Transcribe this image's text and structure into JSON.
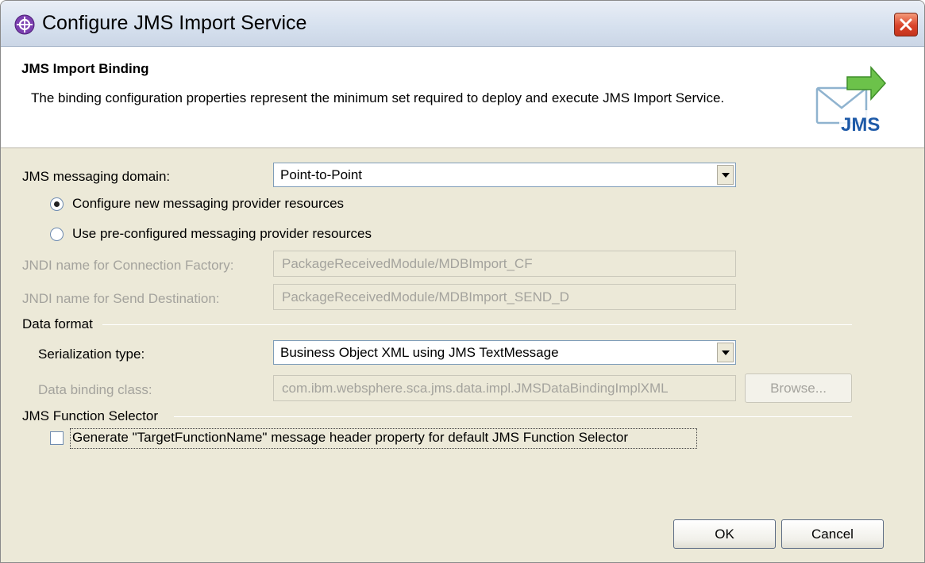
{
  "window": {
    "title": "Configure JMS Import Service",
    "app_icon": "eclipse-plugin-icon",
    "close_icon": "close-icon"
  },
  "header": {
    "title": "JMS Import Binding",
    "description": "The binding configuration properties represent the minimum set required to deploy and execute JMS Import Service.",
    "logo_text": "JMS"
  },
  "form": {
    "messaging_domain_label": "JMS messaging domain:",
    "messaging_domain_value": "Point-to-Point",
    "radio_new_label": "Configure new messaging provider resources",
    "radio_new_checked": true,
    "radio_pre_label": "Use pre-configured messaging provider resources",
    "radio_pre_checked": false,
    "jndi_cf_label": "JNDI name for Connection Factory:",
    "jndi_cf_value": "PackageReceivedModule/MDBImport_CF",
    "jndi_send_label": "JNDI name for Send Destination:",
    "jndi_send_value": "PackageReceivedModule/MDBImport_SEND_D"
  },
  "data_format": {
    "group_label": "Data format",
    "serialization_label": "Serialization type:",
    "serialization_value": "Business Object XML using JMS TextMessage",
    "binding_class_label": "Data binding class:",
    "binding_class_value": "com.ibm.websphere.sca.jms.data.impl.JMSDataBindingImplXML",
    "browse_label": "Browse..."
  },
  "function_selector": {
    "group_label": "JMS Function Selector",
    "checkbox_label": "Generate \"TargetFunctionName\" message header property for default JMS Function Selector",
    "checkbox_checked": false
  },
  "buttons": {
    "ok": "OK",
    "cancel": "Cancel"
  }
}
